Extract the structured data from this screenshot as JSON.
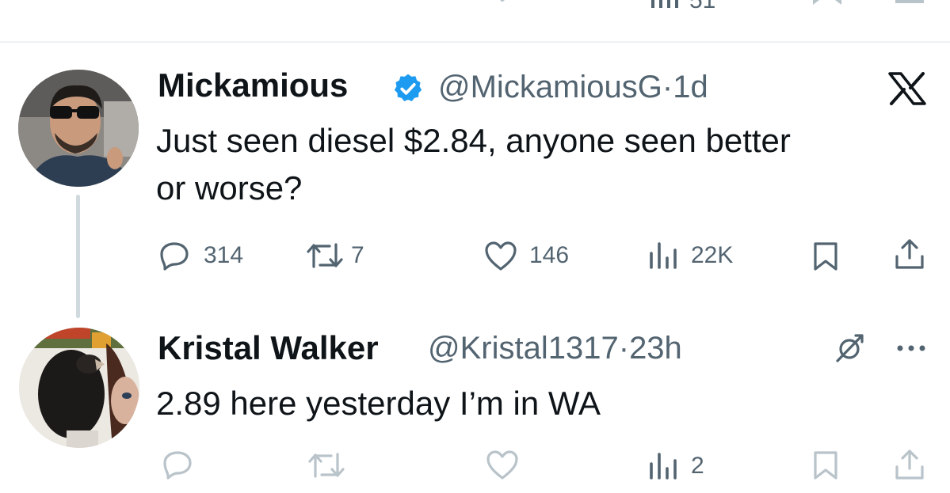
{
  "top_partial_actions": {
    "views_count": "51"
  },
  "tweet1": {
    "author_name": "Mickamious",
    "handle": "@MickamiousG",
    "separator": "·",
    "time": "1d",
    "text_line1": "Just seen diesel $2.84, anyone seen better",
    "text_line2": "or worse?",
    "replies": "314",
    "reposts": "7",
    "likes": "146",
    "views": "22K"
  },
  "tweet2": {
    "author_name": "Kristal Walker",
    "handle": "@Kristal1317",
    "separator": "·",
    "time": "23h",
    "text": "2.89 here yesterday I’m in WA",
    "views": "2"
  },
  "colors": {
    "text": "#0f1419",
    "muted": "#536471",
    "faded_icons": "#b9c3ca",
    "verified": "#1d9bf0",
    "thread_line": "#cfd9de"
  },
  "icons": [
    "verified-badge-icon",
    "x-logo-icon",
    "reply-icon",
    "repost-icon",
    "like-icon",
    "views-icon",
    "bookmark-icon",
    "share-icon",
    "grok-icon",
    "more-icon"
  ]
}
